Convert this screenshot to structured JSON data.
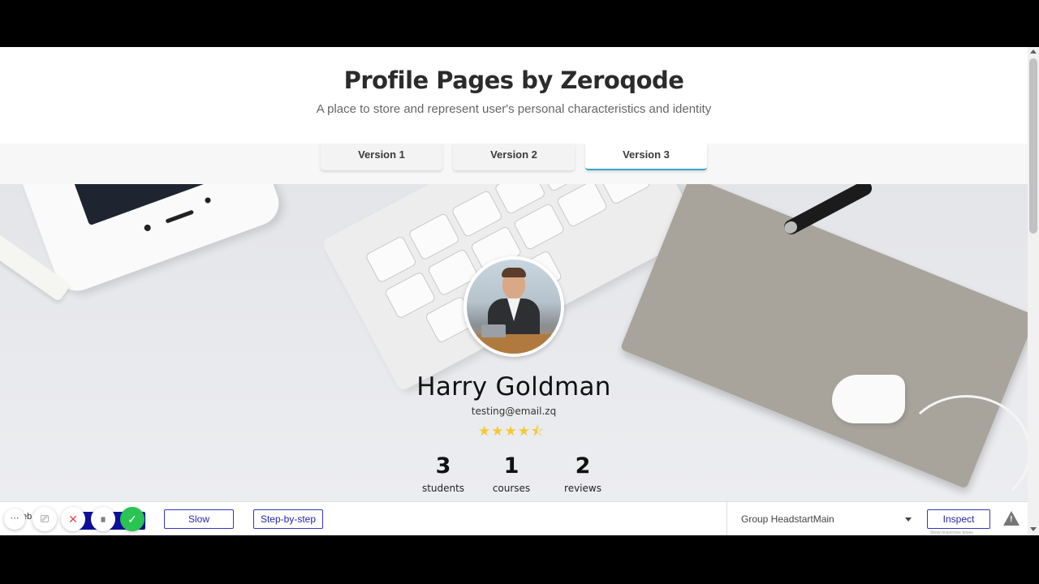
{
  "header": {
    "title": "Profile Pages by Zeroqode",
    "subtitle": "A place to store and represent user's personal characteristics and identity"
  },
  "tabs": [
    {
      "label": "Version 1"
    },
    {
      "label": "Version 2"
    },
    {
      "label": "Version 3",
      "active": true
    }
  ],
  "profile": {
    "name": "Harry Goldman",
    "email": "testing@email.zq",
    "rating": 4.5,
    "rating_display": "★★★★⯪",
    "stats": [
      {
        "value": "3",
        "label": "students"
      },
      {
        "value": "1",
        "label": "courses"
      },
      {
        "value": "2",
        "label": "reviews"
      }
    ]
  },
  "toolbar": {
    "peek_text": "eb",
    "slow_label": "Slow",
    "step_label": "Step-by-step",
    "group_select": "Group HeadstartMain",
    "inspect_label": "Inspect",
    "hint": "Show responsive boxes",
    "warning_glyph": "!"
  },
  "controls": {
    "more_glyph": "⋯",
    "camera_glyph": "⎚",
    "close_glyph": "✕",
    "pause_glyph": "⏸",
    "done_glyph": "✓"
  },
  "colors": {
    "active_tab_underline": "#3aa6c2",
    "star": "#f3c935",
    "toolbar_button": "#2525b0",
    "done_green": "#29c452"
  }
}
